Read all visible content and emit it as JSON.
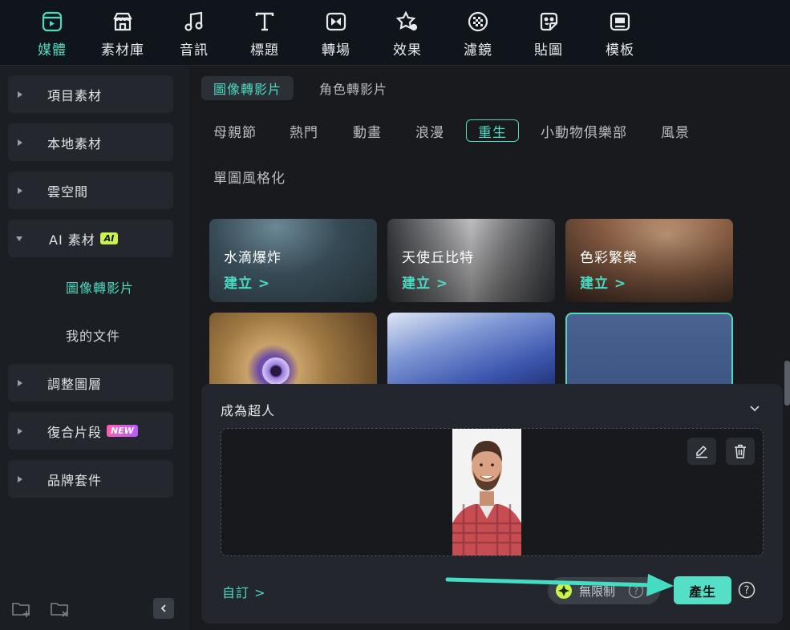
{
  "toolbar": {
    "items": [
      {
        "label": "媒體",
        "icon": "media-icon"
      },
      {
        "label": "素材庫",
        "icon": "store-icon"
      },
      {
        "label": "音訊",
        "icon": "music-note-icon"
      },
      {
        "label": "標題",
        "icon": "text-icon"
      },
      {
        "label": "轉場",
        "icon": "transition-icon"
      },
      {
        "label": "效果",
        "icon": "effects-icon"
      },
      {
        "label": "濾鏡",
        "icon": "filter-icon"
      },
      {
        "label": "貼圖",
        "icon": "sticker-icon"
      },
      {
        "label": "模板",
        "icon": "template-icon"
      }
    ],
    "accent": "#4ed9c2"
  },
  "sidebar": {
    "items": [
      {
        "label": "項目素材"
      },
      {
        "label": "本地素材"
      },
      {
        "label": "雲空間"
      },
      {
        "label": "AI 素材",
        "badge": "AI"
      },
      {
        "label": "調整圖層"
      },
      {
        "label": "復合片段",
        "badge": "NEW"
      },
      {
        "label": "品牌套件"
      }
    ],
    "sub_items": [
      {
        "label": "圖像轉影片"
      },
      {
        "label": "我的文件"
      }
    ]
  },
  "main": {
    "tabs": [
      {
        "label": "圖像轉影片"
      },
      {
        "label": "角色轉影片"
      }
    ],
    "categories": [
      {
        "label": "母親節"
      },
      {
        "label": "熱門"
      },
      {
        "label": "動畫"
      },
      {
        "label": "浪漫"
      },
      {
        "label": "重生"
      },
      {
        "label": "小動物俱樂部"
      },
      {
        "label": "風景"
      },
      {
        "label": "單圖風格化"
      }
    ],
    "cards": [
      {
        "title": "水滴爆炸",
        "link": "建立 >"
      },
      {
        "title": "天使丘比特",
        "link": "建立 >"
      },
      {
        "title": "色彩繁榮",
        "link": "建立 >"
      }
    ]
  },
  "panel": {
    "title": "成為超人",
    "custom_link": "自訂 >",
    "unlimited_label": "無限制",
    "generate_label": "產生"
  }
}
